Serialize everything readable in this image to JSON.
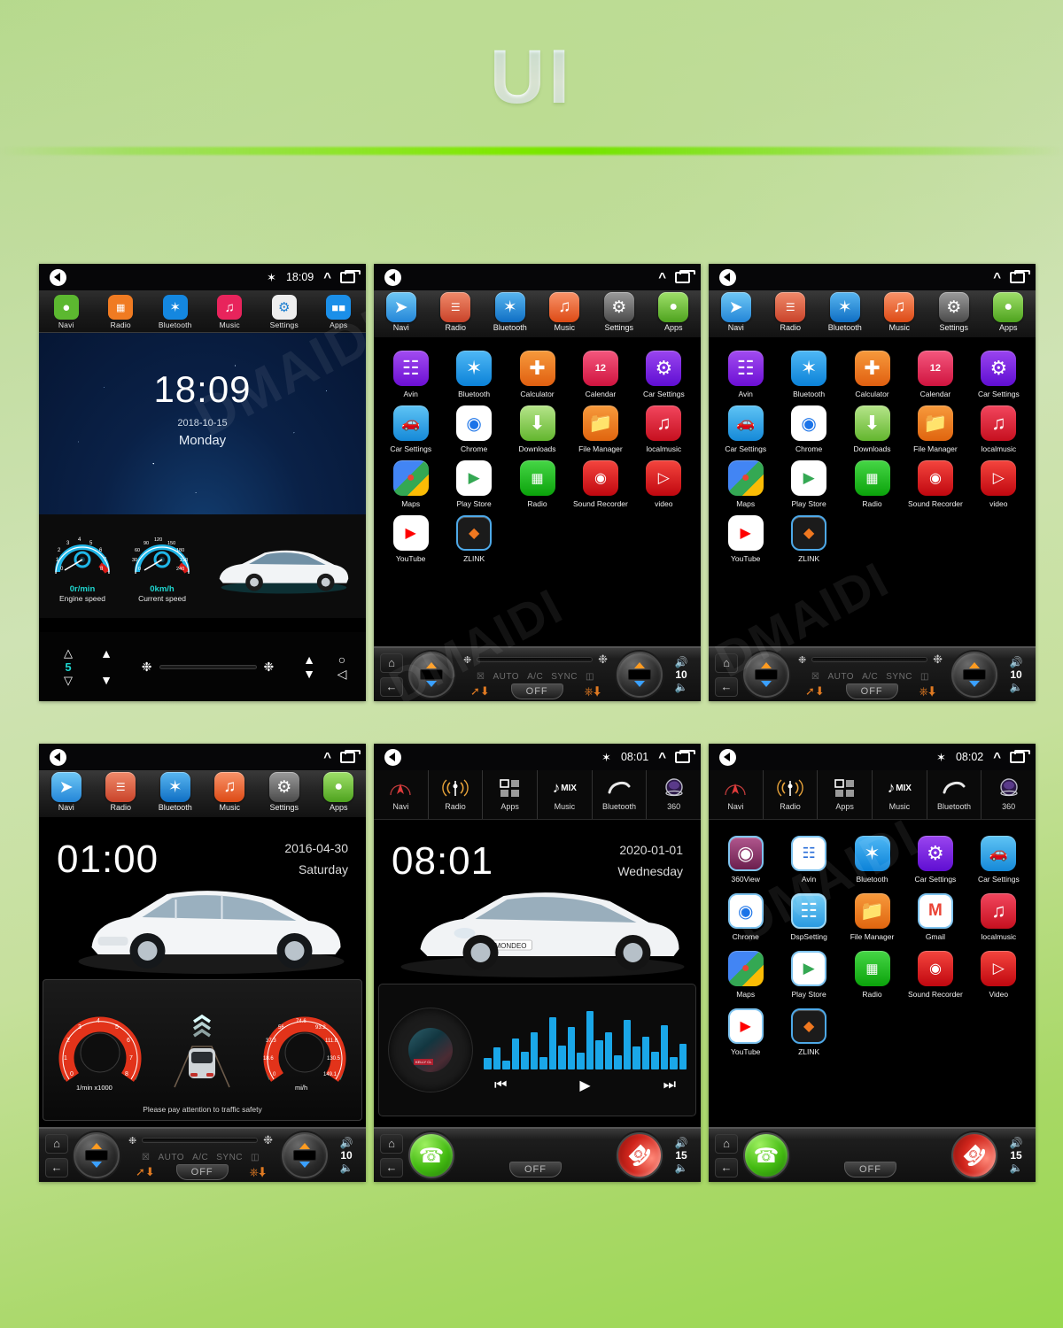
{
  "header": {
    "title": "UI"
  },
  "screens": [
    {
      "id": "home-starfield",
      "status": {
        "bluetooth": "bluetooth-icon",
        "time": "18:09",
        "chevron": "chevron-up-icon",
        "recents": "recents-icon",
        "back": "back-icon"
      },
      "dock_style": "flat",
      "dock": [
        {
          "label": "Navi",
          "icon": "location-pin-icon",
          "color": "#5cb830"
        },
        {
          "label": "Radio",
          "icon": "radio-icon",
          "color": "#f07b22"
        },
        {
          "label": "Bluetooth",
          "icon": "bluetooth-icon",
          "color": "#1487e0"
        },
        {
          "label": "Music",
          "icon": "music-note-icon",
          "color": "#e8245c"
        },
        {
          "label": "Settings",
          "icon": "gear-icon",
          "color": "#eeeeee"
        },
        {
          "label": "Apps",
          "icon": "apps-grid-icon",
          "color": "#1b8fe8"
        }
      ],
      "clock": {
        "time": "18:09",
        "date": "2018-10-15",
        "weekday": "Monday"
      },
      "gauges": [
        {
          "value": "0r/min",
          "caption": "Engine speed",
          "ticks": [
            "0",
            "1",
            "2",
            "3",
            "4",
            "5",
            "6",
            "7",
            "8"
          ],
          "unit": "r/min"
        },
        {
          "value": "0km/h",
          "caption": "Current speed",
          "ticks": [
            "0",
            "30",
            "60",
            "90",
            "120",
            "150",
            "180",
            "210",
            "240"
          ],
          "unit": "km/h"
        }
      ],
      "bottom_style": "arrows",
      "bottom": {
        "fan_level": "5",
        "circle": "circle-icon",
        "triangle": "triangle-left-icon"
      }
    },
    {
      "id": "apps-grid-1",
      "status": {
        "time": "",
        "chevron": "chevron-up-icon",
        "recents": "recents-icon",
        "back": "back-icon"
      },
      "dock_style": "glossy",
      "dock": [
        {
          "label": "Navi",
          "icon": "navi-arrow-icon",
          "color": "#3ca8ee"
        },
        {
          "label": "Radio",
          "icon": "radio-icon",
          "color": "#e8573a"
        },
        {
          "label": "Bluetooth",
          "icon": "bluetooth-icon",
          "color": "#1a8fe3"
        },
        {
          "label": "Music",
          "icon": "music-note-icon",
          "color": "#ef6a2a"
        },
        {
          "label": "Settings",
          "icon": "gear-icon",
          "color": "#6d6d6d"
        },
        {
          "label": "Apps",
          "icon": "android-robot-icon",
          "color": "#6cc644"
        }
      ],
      "apps": [
        {
          "label": "Avin",
          "icon": "sliders-icon",
          "color": "#7b22e0"
        },
        {
          "label": "Bluetooth",
          "icon": "bluetooth-icon",
          "color": "#1a9ae8"
        },
        {
          "label": "Calculator",
          "icon": "calculator-icon",
          "color": "#f07820"
        },
        {
          "label": "Calendar",
          "icon": "calendar-icon",
          "color": "#ea2a55"
        },
        {
          "label": "Car Settings",
          "icon": "gear-icon",
          "color": "#7a1ee4"
        },
        {
          "label": "Car Settings",
          "icon": "car-icon",
          "color": "#29a9e8"
        },
        {
          "label": "Chrome",
          "icon": "chrome-icon",
          "color": "#ffffff"
        },
        {
          "label": "Downloads",
          "icon": "download-icon",
          "color": "#8ecf5a"
        },
        {
          "label": "File Manager",
          "icon": "folder-icon",
          "color": "#f07820"
        },
        {
          "label": "localmusic",
          "icon": "music-note-icon",
          "color": "#e51f3e"
        },
        {
          "label": "Maps",
          "icon": "maps-pin-icon",
          "color": "#ffffff"
        },
        {
          "label": "Play Store",
          "icon": "play-store-icon",
          "color": "#ffffff"
        },
        {
          "label": "Radio",
          "icon": "radio-icon",
          "color": "#16bb16"
        },
        {
          "label": "Sound Recorder",
          "icon": "record-icon",
          "color": "#e5161f"
        },
        {
          "label": "video",
          "icon": "play-circle-icon",
          "color": "#e5161f"
        },
        {
          "label": "YouTube",
          "icon": "youtube-icon",
          "color": "#ffffff"
        },
        {
          "label": "ZLINK",
          "icon": "zlink-icon",
          "color": "#1b1b1b"
        }
      ],
      "bottom_style": "climate",
      "climate": {
        "home": "home-icon",
        "back": "back-arrow-icon",
        "auto": "AUTO",
        "ac": "A/C",
        "sync": "SYNC",
        "defrost": "defrost-icon",
        "rear_defrost": "rear-defrost-icon",
        "off": "OFF",
        "volume": "10"
      }
    },
    {
      "id": "apps-grid-2",
      "status": {
        "time": "",
        "chevron": "chevron-up-icon",
        "recents": "recents-icon",
        "back": "back-icon"
      },
      "dock_style": "glossy",
      "dock": [
        {
          "label": "Navi",
          "icon": "navi-arrow-icon",
          "color": "#3ca8ee"
        },
        {
          "label": "Radio",
          "icon": "radio-icon",
          "color": "#e8573a"
        },
        {
          "label": "Bluetooth",
          "icon": "bluetooth-icon",
          "color": "#1a8fe3"
        },
        {
          "label": "Music",
          "icon": "music-note-icon",
          "color": "#ef6a2a"
        },
        {
          "label": "Settings",
          "icon": "gear-icon",
          "color": "#6d6d6d"
        },
        {
          "label": "Apps",
          "icon": "android-robot-icon",
          "color": "#6cc644"
        }
      ],
      "apps": [
        {
          "label": "Avin",
          "icon": "sliders-icon",
          "color": "#7b22e0"
        },
        {
          "label": "Bluetooth",
          "icon": "bluetooth-icon",
          "color": "#1a9ae8"
        },
        {
          "label": "Calculator",
          "icon": "calculator-icon",
          "color": "#f07820"
        },
        {
          "label": "Calendar",
          "icon": "calendar-icon",
          "color": "#ea2a55"
        },
        {
          "label": "Car Settings",
          "icon": "gear-icon",
          "color": "#7a1ee4"
        },
        {
          "label": "Car Settings",
          "icon": "car-icon",
          "color": "#29a9e8"
        },
        {
          "label": "Chrome",
          "icon": "chrome-icon",
          "color": "#ffffff"
        },
        {
          "label": "Downloads",
          "icon": "download-icon",
          "color": "#8ecf5a"
        },
        {
          "label": "File Manager",
          "icon": "folder-icon",
          "color": "#f07820"
        },
        {
          "label": "localmusic",
          "icon": "music-note-icon",
          "color": "#e51f3e"
        },
        {
          "label": "Maps",
          "icon": "maps-pin-icon",
          "color": "#ffffff"
        },
        {
          "label": "Play Store",
          "icon": "play-store-icon",
          "color": "#ffffff"
        },
        {
          "label": "Radio",
          "icon": "radio-icon",
          "color": "#16bb16"
        },
        {
          "label": "Sound Recorder",
          "icon": "record-icon",
          "color": "#e5161f"
        },
        {
          "label": "video",
          "icon": "play-circle-icon",
          "color": "#e5161f"
        },
        {
          "label": "YouTube",
          "icon": "youtube-icon",
          "color": "#ffffff"
        },
        {
          "label": "ZLINK",
          "icon": "zlink-icon",
          "color": "#1b1b1b"
        }
      ],
      "bottom_style": "climate",
      "climate": {
        "home": "home-icon",
        "back": "back-arrow-icon",
        "auto": "AUTO",
        "ac": "A/C",
        "sync": "SYNC",
        "defrost": "defrost-icon",
        "rear_defrost": "rear-defrost-icon",
        "off": "OFF",
        "volume": "10"
      }
    },
    {
      "id": "home-buick",
      "status": {
        "time": "",
        "chevron": "chevron-up-icon",
        "recents": "recents-icon",
        "back": "back-icon"
      },
      "dock_style": "glossy",
      "dock": [
        {
          "label": "Navi",
          "icon": "navi-arrow-icon",
          "color": "#3ca8ee"
        },
        {
          "label": "Radio",
          "icon": "radio-icon",
          "color": "#e8573a"
        },
        {
          "label": "Bluetooth",
          "icon": "bluetooth-icon",
          "color": "#1a8fe3"
        },
        {
          "label": "Music",
          "icon": "music-note-icon",
          "color": "#ef6a2a"
        },
        {
          "label": "Settings",
          "icon": "gear-icon",
          "color": "#6d6d6d"
        },
        {
          "label": "Apps",
          "icon": "android-robot-icon",
          "color": "#6cc644"
        }
      ],
      "clock": {
        "time": "01:00",
        "date": "2016-04-30",
        "weekday": "Saturday"
      },
      "cluster": {
        "left_unit": "1/min x1000",
        "left_ticks": [
          "0",
          "1",
          "2",
          "3",
          "4",
          "5",
          "6",
          "7",
          "8"
        ],
        "right_unit": "mi/h",
        "right_ticks": [
          "0",
          "18.6",
          "37.3",
          "56",
          "74.6",
          "93.2",
          "111.8",
          "130.5",
          "149.1"
        ],
        "note": "Please pay attention to traffic safety"
      },
      "bottom_style": "climate",
      "climate": {
        "home": "home-icon",
        "back": "back-arrow-icon",
        "auto": "AUTO",
        "ac": "A/C",
        "sync": "SYNC",
        "defrost": "defrost-icon",
        "rear_defrost": "rear-defrost-icon",
        "off": "OFF",
        "volume": "10"
      }
    },
    {
      "id": "home-mondeo",
      "status": {
        "bluetooth": "bluetooth-icon",
        "time": "08:01",
        "chevron": "chevron-up-icon",
        "recents": "recents-icon",
        "back": "back-icon"
      },
      "dock_style": "lineart",
      "dock": [
        {
          "label": "Navi",
          "icon": "compass-icon"
        },
        {
          "label": "Radio",
          "icon": "radio-tower-icon"
        },
        {
          "label": "Apps",
          "icon": "four-squares-icon"
        },
        {
          "label": "Music",
          "icon": "music-mix-icon",
          "badge": "MIX"
        },
        {
          "label": "Bluetooth",
          "icon": "handset-icon"
        },
        {
          "label": "360",
          "icon": "camera-360-icon"
        }
      ],
      "clock": {
        "time": "08:01",
        "date": "2020-01-01",
        "weekday": "Wednesday"
      },
      "player": {
        "album_label": "KELLY CL",
        "prev": "prev-track-icon",
        "play": "play-icon",
        "next": "next-track-icon",
        "eq_bars": [
          3,
          5,
          2,
          6,
          4,
          7,
          3,
          9,
          5,
          8,
          4,
          10,
          6,
          7,
          3,
          9,
          5,
          6,
          4,
          8,
          3,
          5
        ]
      },
      "bottom_style": "phone",
      "phone_bar": {
        "home": "home-icon",
        "back": "back-arrow-icon",
        "answer": "phone-answer-icon",
        "hangup": "phone-hangup-icon",
        "off": "OFF",
        "volume": "15"
      }
    },
    {
      "id": "apps-grid-3",
      "status": {
        "bluetooth": "bluetooth-icon",
        "time": "08:02",
        "chevron": "chevron-up-icon",
        "recents": "recents-icon",
        "back": "back-icon"
      },
      "dock_style": "lineart",
      "dock": [
        {
          "label": "Navi",
          "icon": "compass-icon"
        },
        {
          "label": "Radio",
          "icon": "radio-tower-icon"
        },
        {
          "label": "Apps",
          "icon": "four-squares-icon"
        },
        {
          "label": "Music",
          "icon": "music-mix-icon",
          "badge": "MIX"
        },
        {
          "label": "Bluetooth",
          "icon": "handset-icon"
        },
        {
          "label": "360",
          "icon": "camera-360-icon"
        }
      ],
      "apps": [
        {
          "label": "360View",
          "icon": "camera-360-icon",
          "color": "#8b2f5e"
        },
        {
          "label": "Avin",
          "icon": "rca-plugs-icon",
          "color": "#ffffff"
        },
        {
          "label": "Bluetooth",
          "icon": "bluetooth-icon",
          "color": "#1a9ae8"
        },
        {
          "label": "Car Settings",
          "icon": "gear-icon",
          "color": "#7a1ee4"
        },
        {
          "label": "Car Settings",
          "icon": "car-icon",
          "color": "#29a9e8"
        },
        {
          "label": "Chrome",
          "icon": "chrome-icon",
          "color": "#ffffff"
        },
        {
          "label": "DspSetting",
          "icon": "sliders-icon",
          "color": "#3fa9e8"
        },
        {
          "label": "File Manager",
          "icon": "folder-icon",
          "color": "#f07820"
        },
        {
          "label": "Gmail",
          "icon": "gmail-icon",
          "color": "#ffffff"
        },
        {
          "label": "localmusic",
          "icon": "music-note-icon",
          "color": "#e51f3e"
        },
        {
          "label": "Maps",
          "icon": "maps-pin-icon",
          "color": "#ffffff"
        },
        {
          "label": "Play Store",
          "icon": "play-store-icon",
          "color": "#ffffff"
        },
        {
          "label": "Radio",
          "icon": "radio-icon",
          "color": "#16bb16"
        },
        {
          "label": "Sound Recorder",
          "icon": "record-icon",
          "color": "#e5161f"
        },
        {
          "label": "Video",
          "icon": "play-circle-icon",
          "color": "#e5161f"
        },
        {
          "label": "YouTube",
          "icon": "youtube-icon",
          "color": "#ffffff"
        },
        {
          "label": "ZLINK",
          "icon": "zlink-icon",
          "color": "#1b1b1b"
        }
      ],
      "bottom_style": "phone",
      "phone_bar": {
        "home": "home-icon",
        "back": "back-arrow-icon",
        "answer": "phone-answer-icon",
        "hangup": "phone-hangup-icon",
        "off": "OFF",
        "volume": "15"
      }
    }
  ],
  "watermark": "DMAIDI",
  "colors": {
    "background_green": "#b6d98d",
    "accent_green": "#7ee800",
    "gauge_cyan": "#1fd6cf",
    "dial_red": "#e2331a"
  }
}
